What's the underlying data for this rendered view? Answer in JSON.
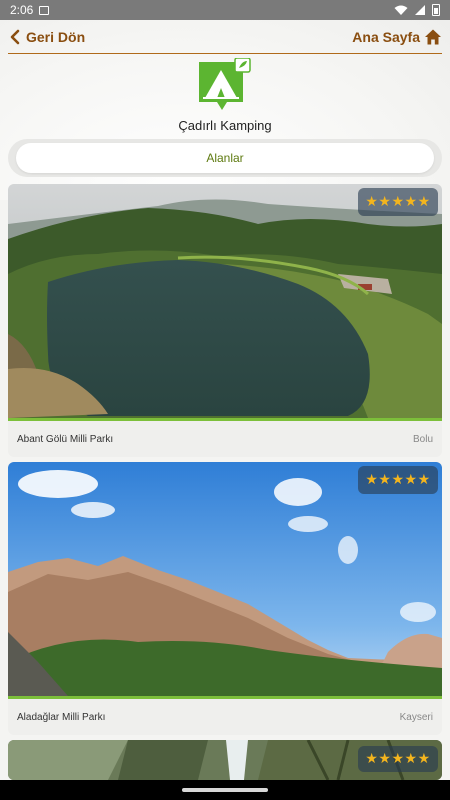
{
  "status_bar": {
    "time": "2:06",
    "icons": [
      "screenshot-icon",
      "wifi-icon",
      "signal-icon",
      "battery-icon"
    ]
  },
  "header": {
    "back_label": "Geri Dön",
    "home_label": "Ana Sayfa",
    "accent_color": "#8a4e10"
  },
  "category": {
    "title": "Çadırlı Kamping",
    "icon": "tent-icon",
    "icon_color": "#5cb531"
  },
  "tabs": [
    {
      "label": "Alanlar",
      "selected": true
    }
  ],
  "places": [
    {
      "name": "Abant Gölü Milli Parkı",
      "city": "Bolu",
      "rating": 5,
      "stars": "★★★★★",
      "image": "lake-aerial"
    },
    {
      "name": "Aladağlar Milli Parkı",
      "city": "Kayseri",
      "rating": 5,
      "stars": "★★★★★",
      "image": "mountain-range"
    },
    {
      "name": "",
      "city": "",
      "rating": 5,
      "stars": "★★★★★",
      "image": "forest-waterfall"
    }
  ],
  "colors": {
    "star": "#f3b51e",
    "divider_green": "#7cbf3a",
    "tab_text": "#5e7a10"
  }
}
